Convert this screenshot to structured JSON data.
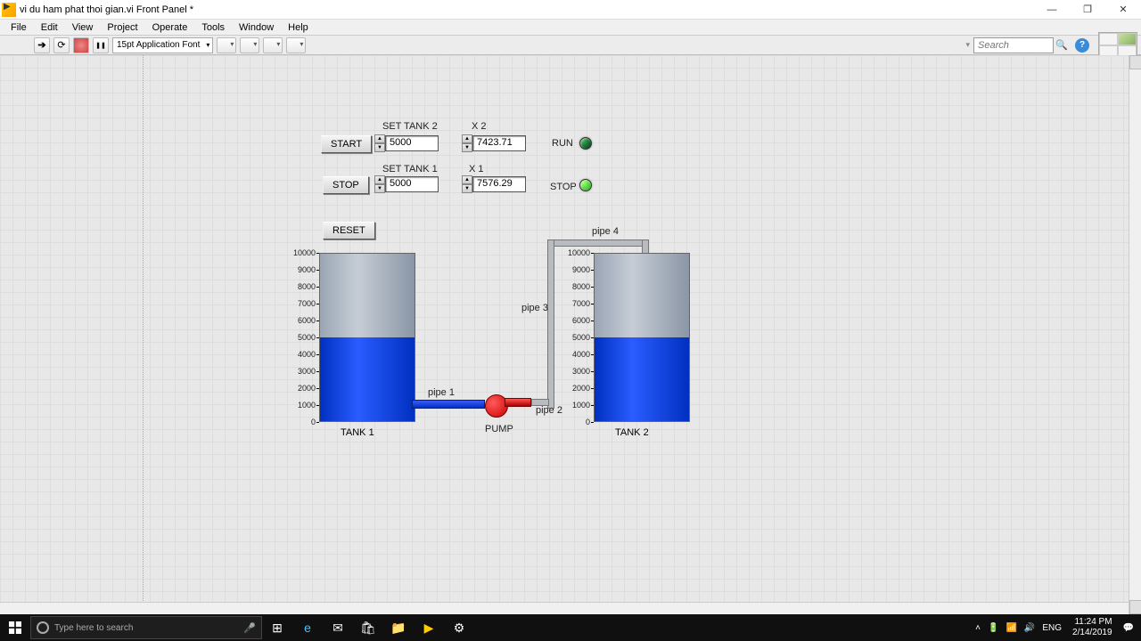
{
  "window": {
    "title": "vi du ham phat thoi gian.vi Front Panel *",
    "minimize": "—",
    "maximize": "❐",
    "close": "✕"
  },
  "menu": {
    "file": "File",
    "edit": "Edit",
    "view": "View",
    "project": "Project",
    "operate": "Operate",
    "tools": "Tools",
    "window": "Window",
    "help": "Help"
  },
  "toolbar": {
    "font": "15pt Application Font",
    "search_placeholder": "Search",
    "help": "?"
  },
  "controls": {
    "start": "START",
    "stop": "STOP",
    "reset": "RESET",
    "set_tank2_label": "SET TANK 2",
    "set_tank2_value": "5000",
    "set_tank1_label": "SET TANK 1",
    "set_tank1_value": "5000",
    "x2_label": "X 2",
    "x2_value": "7423.71",
    "x1_label": "X 1",
    "x1_value": "7576.29",
    "run_label": "RUN",
    "stop_label": "STOP"
  },
  "tanks": {
    "tank1": {
      "name": "TANK 1",
      "max": 10000,
      "level": 5000
    },
    "tank2": {
      "name": "TANK 2",
      "max": 10000,
      "level": 5000
    },
    "scale": [
      "10000",
      "9000",
      "8000",
      "7000",
      "6000",
      "5000",
      "4000",
      "3000",
      "2000",
      "1000",
      "0"
    ]
  },
  "pipes": {
    "p1": "pipe 1",
    "p2": "pipe 2",
    "p3": "pipe 3",
    "p4": "pipe 4",
    "pump": "PUMP"
  },
  "taskbar": {
    "search_placeholder": "Type here to search",
    "lang": "ENG",
    "time": "11:24 PM",
    "date": "2/14/2019"
  }
}
